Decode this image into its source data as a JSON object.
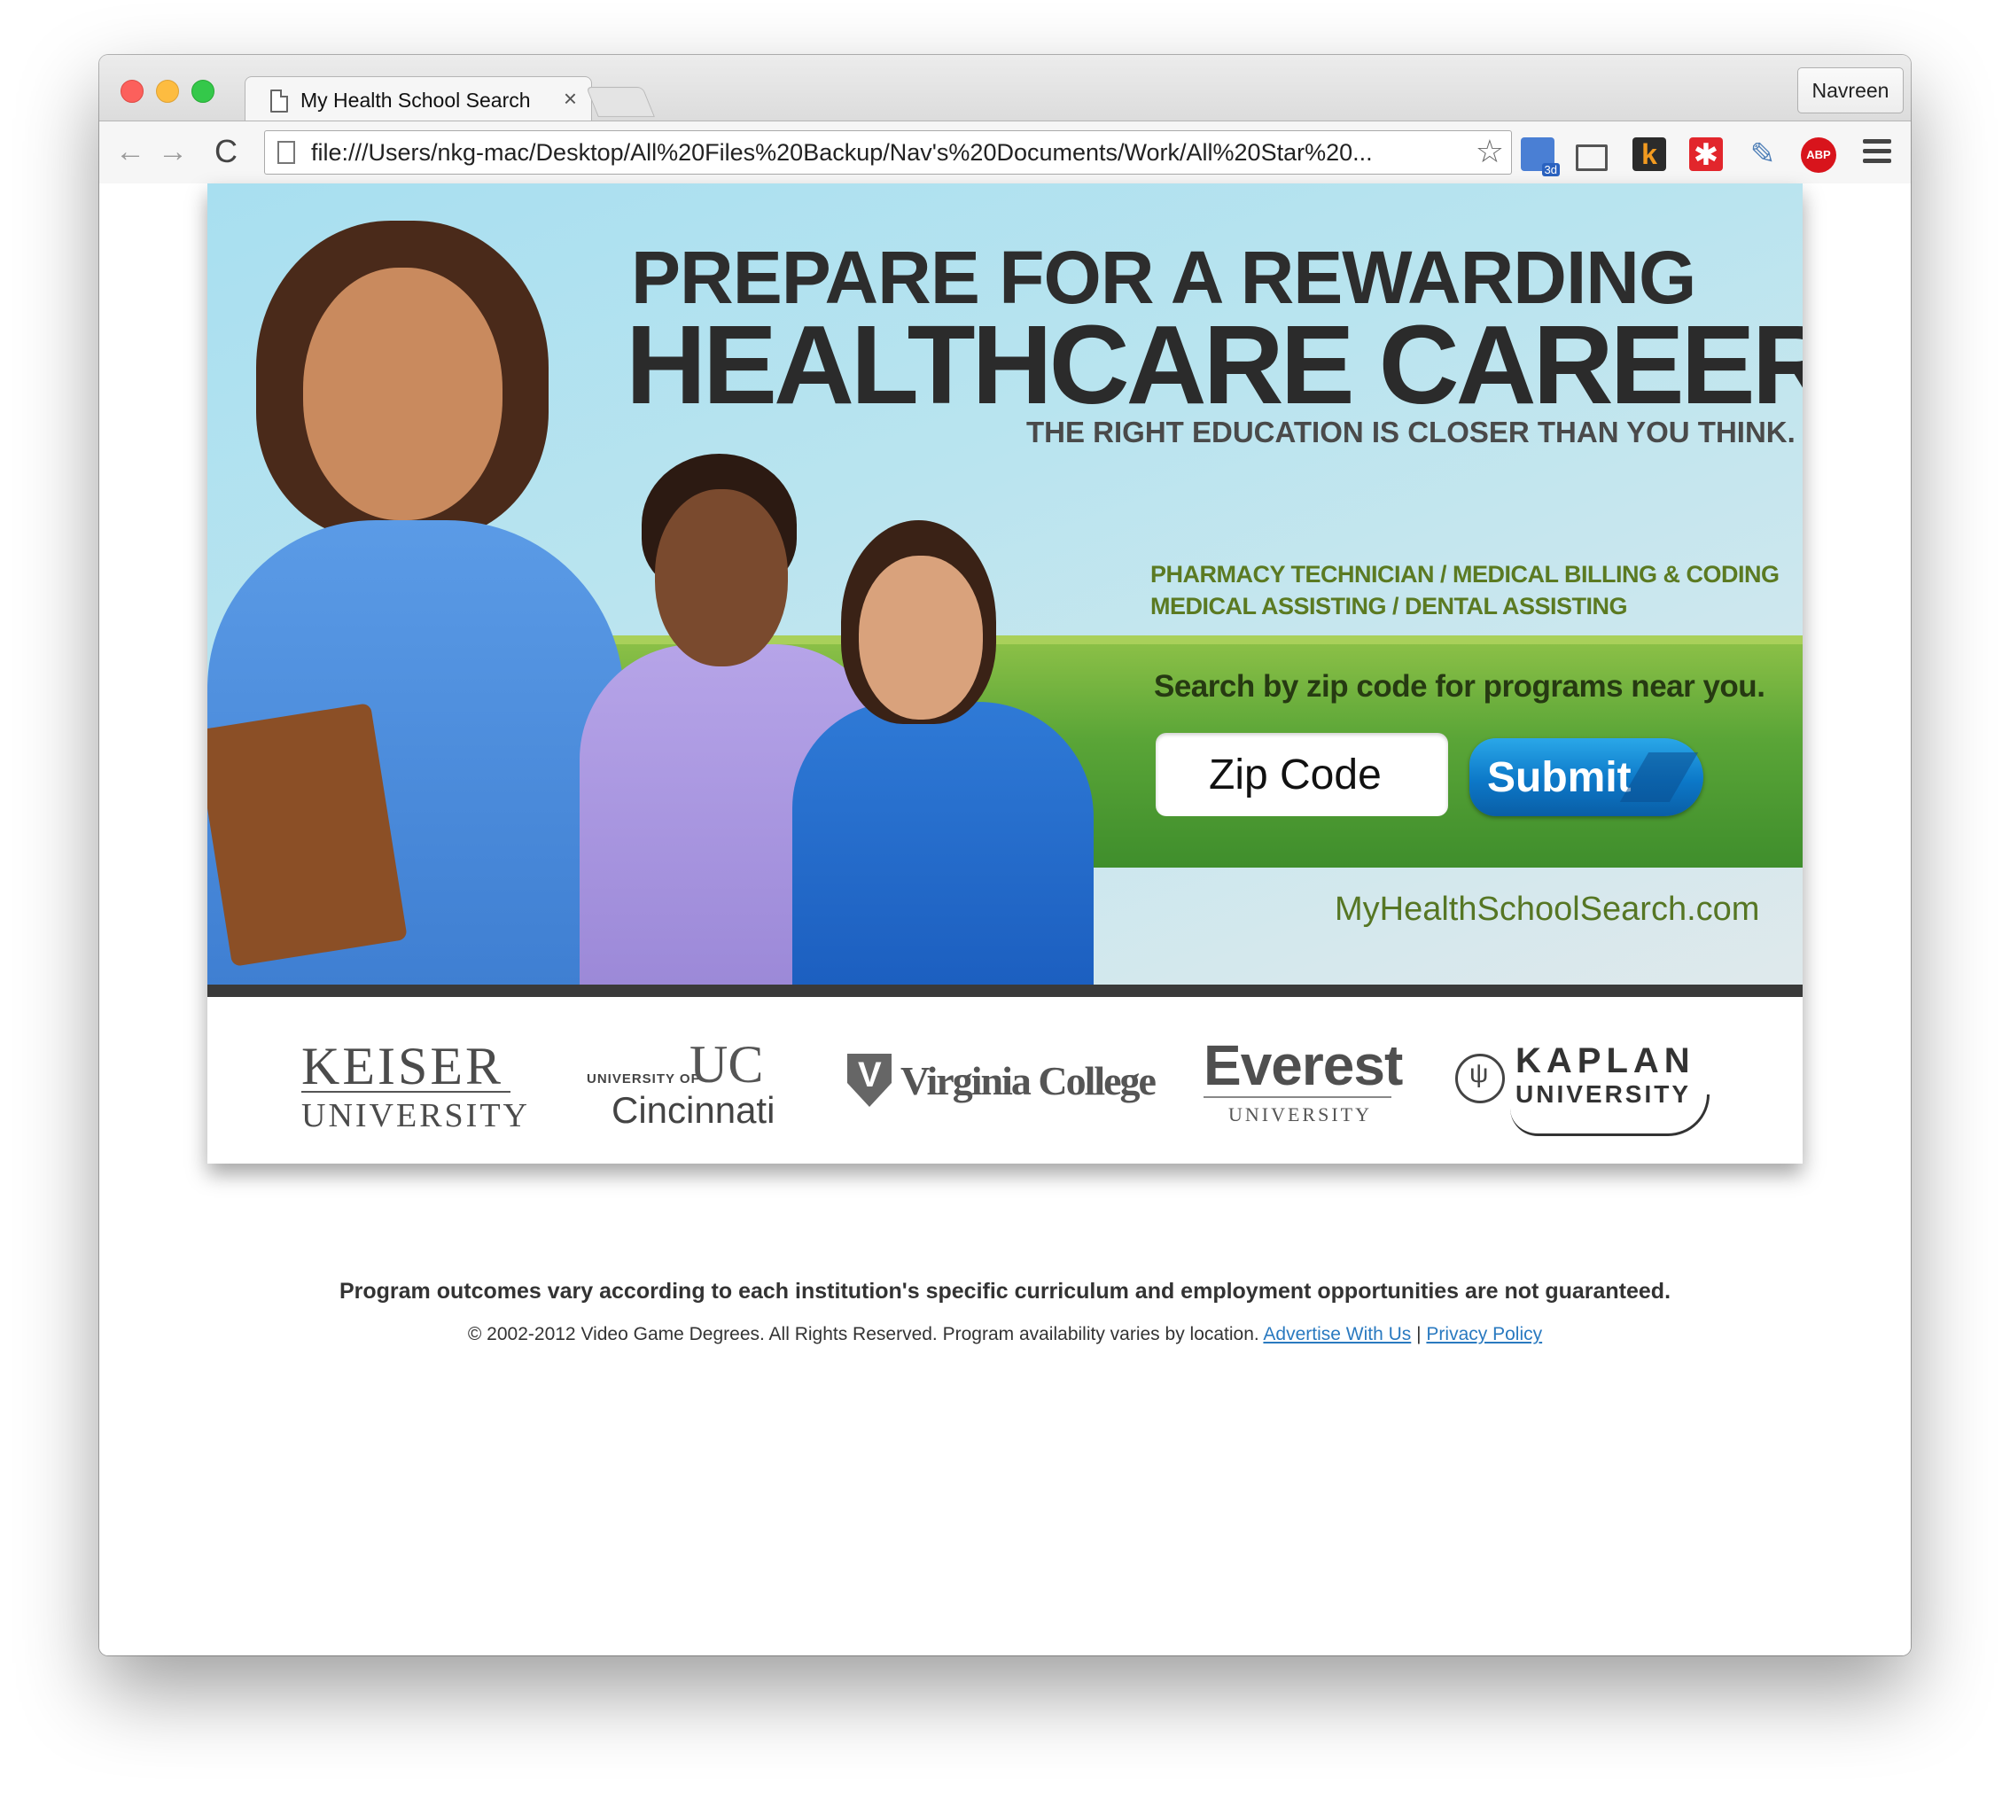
{
  "browser": {
    "tab_title": "My Health School Search",
    "tab_close": "×",
    "profile_name": "Navreen",
    "url": "file:///Users/nkg-mac/Desktop/All%20Files%20Backup/Nav's%20Documents/Work/All%20Star%20...",
    "back_icon": "←",
    "forward_icon": "→",
    "reload_icon": "C",
    "star_icon": "☆",
    "extensions": {
      "ext3_label": "k",
      "ext4_label": "✱",
      "ext5_label": "✎",
      "adblock_label": "ABP"
    }
  },
  "banner": {
    "headline_line1": "PREPARE FOR A REWARDING",
    "headline_line2": "HEALTHCARE CAREER",
    "tagline": "THE RIGHT EDUCATION IS CLOSER THAN YOU THINK.",
    "programs_line1": "PHARMACY TECHNICIAN  /  MEDICAL BILLING & CODING",
    "programs_line2": "MEDICAL ASSISTING  /  DENTAL ASSISTING",
    "search_label": "Search by zip code for programs near you.",
    "zip_placeholder": "Zip Code",
    "submit_label": "Submit",
    "site_url": "MyHealthSchoolSearch.com"
  },
  "logos": {
    "keiser_line1": "KEISER",
    "keiser_line2": "UNIVERSITY",
    "cincinnati_prefix": "UNIVERSITY OF",
    "cincinnati_mark": "UC",
    "cincinnati_name": "Cincinnati",
    "virginia_mark": "V",
    "virginia_name": "Virginia College",
    "everest_name": "Everest",
    "everest_sub": "UNIVERSITY",
    "kaplan_mark": "ψ",
    "kaplan_name": "KAPLAN",
    "kaplan_sub": "UNIVERSITY"
  },
  "footer": {
    "disclaimer": "Program outcomes vary according to each institution's specific curriculum and employment opportunities are not guaranteed.",
    "copyright": "© 2002-2012 Video Game Degrees. All Rights Reserved. Program availability varies by location. ",
    "advertise_link": "Advertise With Us",
    "separator": " | ",
    "privacy_link": "Privacy Policy"
  },
  "colors": {
    "sky": "#a8dff0",
    "green_band": "#5aa537",
    "submit_blue": "#0c78c8",
    "program_text": "#5b7a22",
    "link": "#2a7ac0"
  }
}
